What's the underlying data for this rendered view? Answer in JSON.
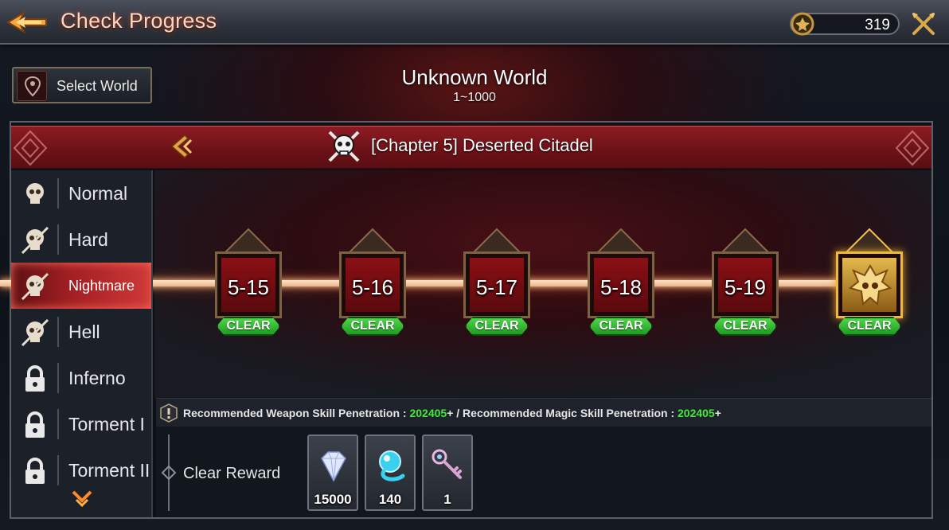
{
  "header": {
    "title": "Check Progress",
    "currency_value": "319"
  },
  "world": {
    "select_label": "Select World",
    "name": "Unknown World",
    "range": "1~1000"
  },
  "chapter": {
    "title": "[Chapter 5] Deserted Citadel"
  },
  "difficulties": [
    {
      "label": "Normal",
      "locked": false,
      "active": false
    },
    {
      "label": "Hard",
      "locked": false,
      "active": false
    },
    {
      "label": "Nightmare",
      "locked": false,
      "active": true
    },
    {
      "label": "Hell",
      "locked": false,
      "active": false
    },
    {
      "label": "Inferno",
      "locked": true,
      "active": false
    },
    {
      "label": "Torment I",
      "locked": true,
      "active": false
    },
    {
      "label": "Torment II",
      "locked": true,
      "active": false
    }
  ],
  "stages": [
    {
      "label": "5-15",
      "status": "CLEAR",
      "boss": false
    },
    {
      "label": "5-16",
      "status": "CLEAR",
      "boss": false
    },
    {
      "label": "5-17",
      "status": "CLEAR",
      "boss": false
    },
    {
      "label": "5-18",
      "status": "CLEAR",
      "boss": false
    },
    {
      "label": "5-19",
      "status": "CLEAR",
      "boss": false
    },
    {
      "label": "",
      "status": "CLEAR",
      "boss": true
    }
  ],
  "recommendation": {
    "weapon_label": "Recommended Weapon Skill Penetration : ",
    "weapon_value": "202405",
    "separator": "+ / ",
    "magic_label": "Recommended Magic Skill Penetration : ",
    "magic_value": "202405",
    "suffix": "+"
  },
  "reward": {
    "label": "Clear Reward",
    "items": [
      {
        "icon": "diamond-icon",
        "qty": "15000"
      },
      {
        "icon": "spirit-orb-icon",
        "qty": "140"
      },
      {
        "icon": "key-icon",
        "qty": "1"
      }
    ]
  },
  "colors": {
    "accent_red": "#8d1c23",
    "clear_green": "#2fb52c",
    "highlight_green": "#45e83a",
    "boss_gold": "#f0b83a"
  }
}
